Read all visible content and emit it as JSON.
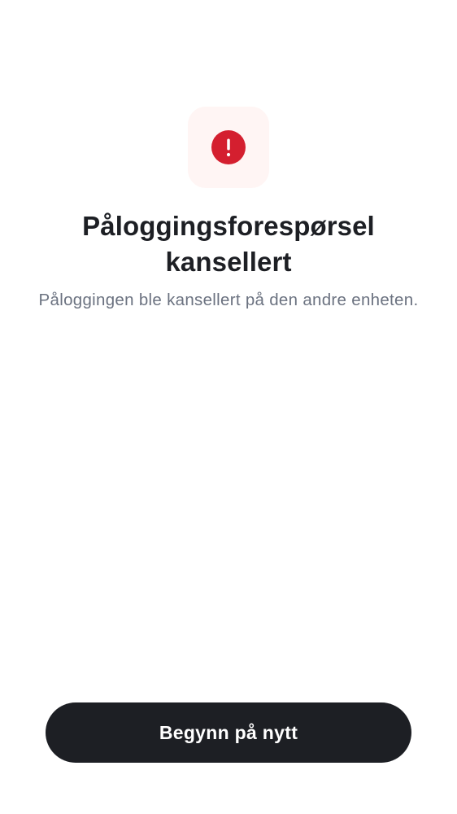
{
  "colors": {
    "background": "#ffffff",
    "icon_tile_background": "#fff5f4",
    "error_red": "#d41f2f",
    "title_text": "#1d1f24",
    "subtitle_text": "#6b7280",
    "button_background": "#1d1f24",
    "button_text": "#ffffff"
  },
  "status": {
    "icon": "exclamation-circle-icon",
    "title": "Påloggingsforespørsel kansellert",
    "message": "Påloggingen ble kansellert på den andre enheten."
  },
  "actions": {
    "restart_label": "Begynn på nytt"
  }
}
